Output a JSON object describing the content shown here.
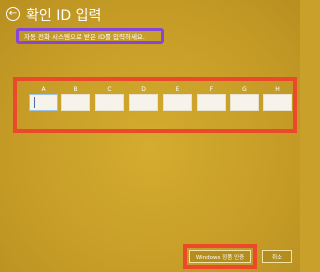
{
  "header": {
    "back_icon": "back-arrow-icon",
    "title": "확인 ID 입력"
  },
  "instruction": "자동 전화 시스템으로 받은 ID를 입력하세요.",
  "id_fields": [
    {
      "letter": "A",
      "value": ""
    },
    {
      "letter": "B",
      "value": ""
    },
    {
      "letter": "C",
      "value": ""
    },
    {
      "letter": "D",
      "value": ""
    },
    {
      "letter": "E",
      "value": ""
    },
    {
      "letter": "F",
      "value": ""
    },
    {
      "letter": "G",
      "value": ""
    },
    {
      "letter": "H",
      "value": ""
    }
  ],
  "buttons": {
    "activate_label": "Windows 정품 인증",
    "cancel_label": "취소"
  },
  "colors": {
    "background": "#c9a12a",
    "highlight_purple": "#8447d8",
    "highlight_red": "#ea4a2a"
  }
}
